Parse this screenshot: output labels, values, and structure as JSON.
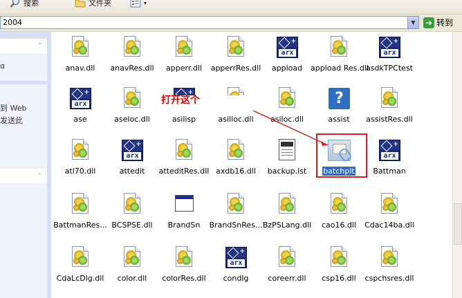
{
  "toolbar": {
    "search_label": "搜索",
    "folders_label": "文件夹",
    "views_icon": "views-icon"
  },
  "address": {
    "value": "2004",
    "go_label": "转到"
  },
  "left_pane": {
    "line1": "ɑ",
    "line2": "到 Web",
    "line3": "发送此"
  },
  "annotation": {
    "text": "打开这个",
    "color": "#e00000"
  },
  "files": [
    {
      "name": "anav.dll",
      "icon": "dll-icon"
    },
    {
      "name": "anavRes.dll",
      "icon": "dll-icon"
    },
    {
      "name": "apperr.dll",
      "icon": "dll-icon"
    },
    {
      "name": "apperrRes.dll",
      "icon": "dll-icon"
    },
    {
      "name": "appload",
      "icon": "arx-icon"
    },
    {
      "name": "appload Res.dll",
      "icon": "dll-icon"
    },
    {
      "name": "asdkTPCtest",
      "icon": "arx-icon"
    },
    {
      "name": "ase",
      "icon": "arx-icon"
    },
    {
      "name": "aseloc.dll",
      "icon": "dll-icon"
    },
    {
      "name": "asilisp",
      "icon": "arx-icon"
    },
    {
      "name": "asilloc.dll",
      "icon": "dll-icon"
    },
    {
      "name": "asiloc.dll",
      "icon": "dll-icon"
    },
    {
      "name": "assist",
      "icon": "assist-icon"
    },
    {
      "name": "assistRes.dll",
      "icon": "dll-icon"
    },
    {
      "name": "atl70.dll",
      "icon": "dll-icon"
    },
    {
      "name": "attedit",
      "icon": "arx-icon"
    },
    {
      "name": "atteditRes.dll",
      "icon": "dll-icon"
    },
    {
      "name": "axdb16.dll",
      "icon": "dll-icon"
    },
    {
      "name": "backup.lst",
      "icon": "lst-icon"
    },
    {
      "name": "batchplt",
      "icon": "batchplt-icon"
    },
    {
      "name": "Battman",
      "icon": "arx-icon"
    },
    {
      "name": "BattmanRes...",
      "icon": "dll-icon"
    },
    {
      "name": "BCSPSE.dll",
      "icon": "dll-icon"
    },
    {
      "name": "BrandSn",
      "icon": "window-icon"
    },
    {
      "name": "BrandSnRes...",
      "icon": "dll-icon"
    },
    {
      "name": "BzPSLang.dll",
      "icon": "dll-icon"
    },
    {
      "name": "cao16.dll",
      "icon": "dll-icon"
    },
    {
      "name": "Cdac14ba.dll",
      "icon": "dll-icon"
    },
    {
      "name": "CdaLcDlg.dll",
      "icon": "dll-icon"
    },
    {
      "name": "color.dll",
      "icon": "dll-icon"
    },
    {
      "name": "colorRes.dll",
      "icon": "dll-icon"
    },
    {
      "name": "condlg",
      "icon": "arx-icon"
    },
    {
      "name": "coreerr.dll",
      "icon": "dll-icon"
    },
    {
      "name": "csp16.dll",
      "icon": "dll-icon"
    },
    {
      "name": "cspchsres.dll",
      "icon": "dll-icon"
    }
  ],
  "arx_text": "arx"
}
